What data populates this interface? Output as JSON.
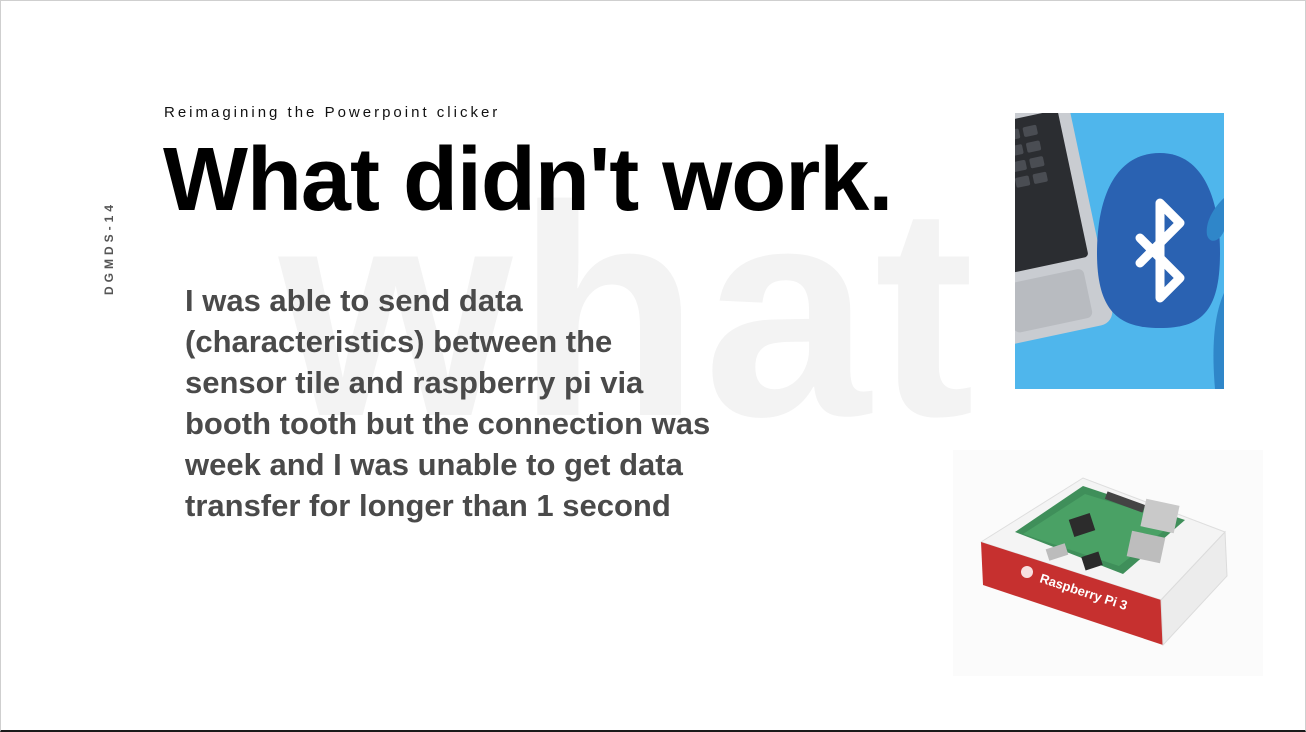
{
  "slide": {
    "watermark": "what",
    "side_code": "DGMDS-14",
    "subtitle": "Reimagining the Powerpoint clicker",
    "title": "What didn't work.",
    "body_lines": [
      "I was able to send data",
      "(characteristics) between the",
      "sensor tile and raspberry pi via",
      "booth tooth but the connection was",
      "week and I was unable to get data",
      "transfer for longer than 1 second"
    ]
  },
  "images": {
    "bluetooth": {
      "icon": "bluetooth-laptop-icon",
      "background_color": "#4fb6ec",
      "logo_color": "#2a62b2"
    },
    "raspberry_pi": {
      "icon": "raspberry-pi-box-icon",
      "box_label": "Raspberry Pi 3",
      "box_color": "#c6302f"
    }
  }
}
